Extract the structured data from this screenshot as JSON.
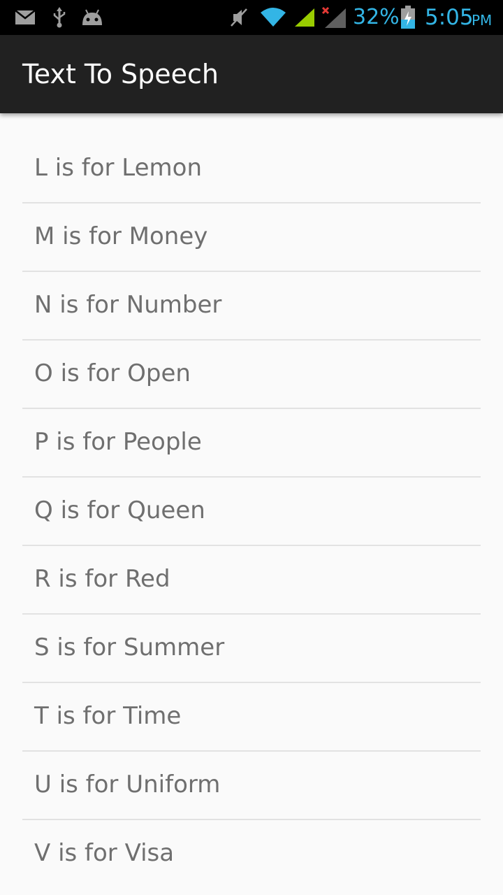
{
  "status_bar": {
    "icons_left": [
      "mail-icon",
      "usb-icon",
      "android-debug-icon"
    ],
    "icons_right": [
      "mute-icon",
      "wifi-icon",
      "signal-icon",
      "no-signal-icon",
      "battery-charging-icon"
    ],
    "battery": "32%",
    "time": "5:05",
    "ampm": "PM",
    "accent_color": "#33b5e5"
  },
  "app_bar": {
    "title": "Text To Speech"
  },
  "list": {
    "items": [
      {
        "label": "L is for Lemon"
      },
      {
        "label": "M is for Money"
      },
      {
        "label": "N is for Number"
      },
      {
        "label": "O is for Open"
      },
      {
        "label": "P is for People"
      },
      {
        "label": "Q is for Queen"
      },
      {
        "label": "R is for Red"
      },
      {
        "label": "S is for Summer"
      },
      {
        "label": "T is for Time"
      },
      {
        "label": "U is for Uniform"
      },
      {
        "label": "V is for Visa"
      }
    ]
  }
}
